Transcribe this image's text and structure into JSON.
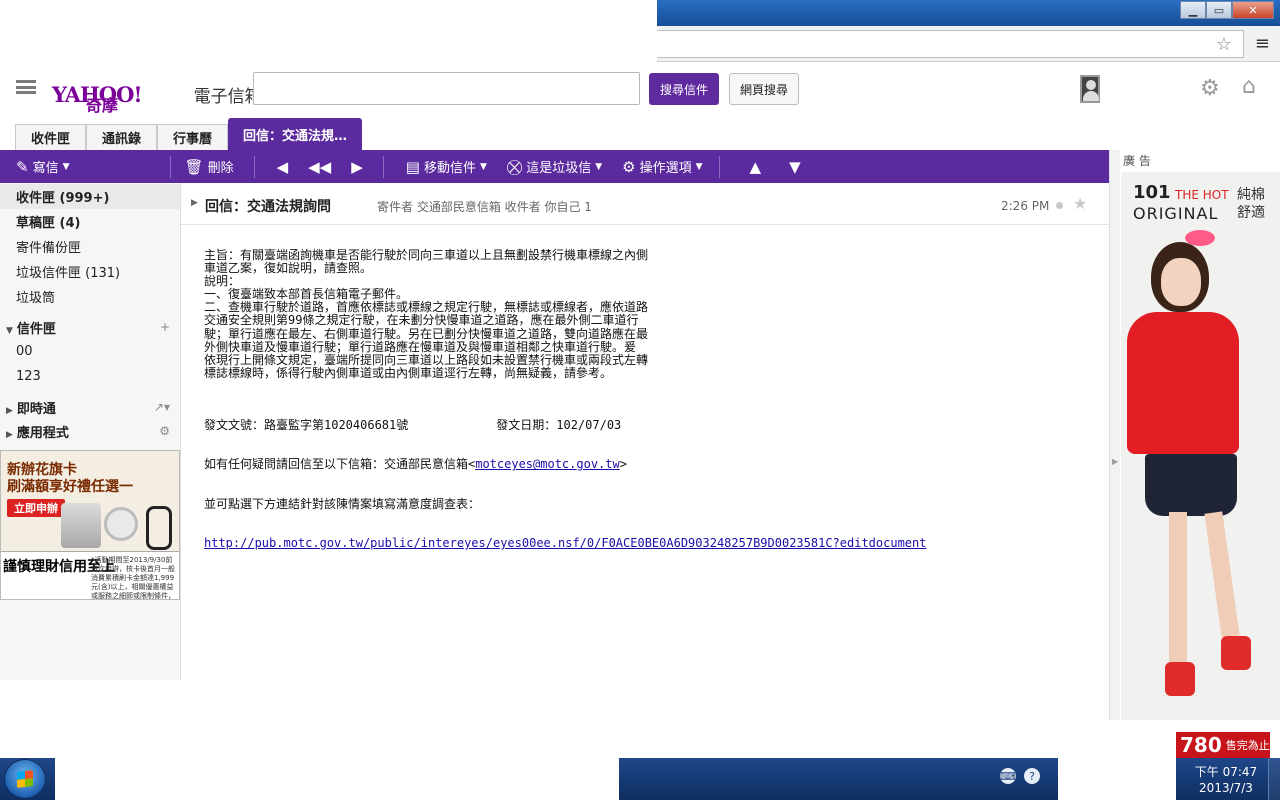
{
  "window": {
    "close_label": "✕",
    "max_label": "▭",
    "min_label": "▁"
  },
  "browser": {
    "star_icon": "☆",
    "menu_icon": "≡"
  },
  "header": {
    "logo_text": "YAHOO!",
    "logo_sub": "奇摩",
    "product": "電子信箱",
    "search_mail_label": "搜尋信件",
    "web_search_label": "網頁搜尋",
    "gear_icon": "⚙",
    "home_icon": "⌂"
  },
  "tabs": [
    {
      "label": "收件匣"
    },
    {
      "label": "通訊錄"
    },
    {
      "label": "行事曆"
    },
    {
      "label": "回信：交通法規…"
    }
  ],
  "toolbar": {
    "compose": "寫信",
    "delete": "刪除",
    "move": "移動信件",
    "spam": "這是垃圾信",
    "actions": "操作選項",
    "icons": {
      "compose": "✎",
      "delete": "🗑",
      "reply": "◀",
      "reply_all": "◀◀",
      "forward": "▶",
      "move": "▤",
      "spam": "⛒",
      "actions": "⚙",
      "up": "▲",
      "down": "▼"
    }
  },
  "sidebar": {
    "folders": [
      {
        "label": "收件匣 (999+)"
      },
      {
        "label": "草稿匣 (4)"
      },
      {
        "label": "寄件備份匣"
      },
      {
        "label": "垃圾信件匣 (131)"
      },
      {
        "label": "垃圾筒"
      }
    ],
    "section_folders": "信件匣",
    "subfolders": [
      {
        "label": "00"
      },
      {
        "label": "123"
      }
    ],
    "section_messenger": "即時通",
    "section_apps": "應用程式"
  },
  "ad_left": {
    "line1": "新辦花旗卡",
    "line2": "刷滿額享好禮任選一",
    "apply": "立即申辦",
    "slogan": "謹慎理財信用至上",
    "fine": "*活動期間至2013/9/30前首次申辦，核卡後首月一般消費累積刷卡金額達1,999元(含)以上，相關優惠權益或服務之細節或限制條件，請上本行網站查詢。"
  },
  "message": {
    "subject": "回信：交通法規詢問",
    "meta": "寄件者 交通部民意信箱  收件者 你自己 1",
    "time": "2:26 PM",
    "star_icon": "★",
    "body_lines": [
      "主旨：有關臺端函詢機車是否能行駛於同向三車道以上且無劃設禁行機車標線之內側",
      "車道乙案，復如說明，請查照。",
      "說明：",
      "一、復臺端致本部首長信箱電子郵件。",
      "二、查機車行駛於道路，首應依標誌或標線之規定行駛，無標誌或標線者，應依道路",
      "交通安全規則第99條之規定行駛，在未劃分快慢車道之道路，應在最外側二車道行",
      "駛；單行道應在最左、右側車道行駛。另在已劃分快慢車道之道路，雙向道路應在最",
      "外側快車道及慢車道行駛；單行道路應在慢車道及與慢車道相鄰之快車道行駛。爰",
      "依現行上開條文規定，臺端所提同向三車道以上路段如未設置禁行機車或兩段式左轉",
      "標誌標線時，係得行駛內側車道或由內側車道逕行左轉，尚無疑義，請參考。"
    ],
    "doc_no": "發文文號：路臺監字第1020406681號",
    "doc_date": "發文日期：102/07/03",
    "contact_prefix": "如有任何疑問請回信至以下信箱：交通部民意信箱<",
    "contact_email": "motceyes@motc.gov.tw",
    "contact_suffix": ">",
    "survey_text": "並可點選下方連結針對該陳情案填寫滿意度調查表：",
    "survey_link": "http://pub.motc.gov.tw/public/intereyes/eyes00ee.nsf/0/F0ACE0BE0A6D903248257B9D0023581C?editdocument"
  },
  "ad_right": {
    "label": "廣 告",
    "brand_num": "101",
    "brand_hot": "THE HOT",
    "brand_orig": "ORIGINAL",
    "brand_side": "純棉舒適",
    "price": "780",
    "price_text": "售完為止"
  },
  "taskbar": {
    "time": "下午 07:47",
    "date": "2013/7/3",
    "tray_keyboard": "⌨",
    "tray_help": "?"
  }
}
